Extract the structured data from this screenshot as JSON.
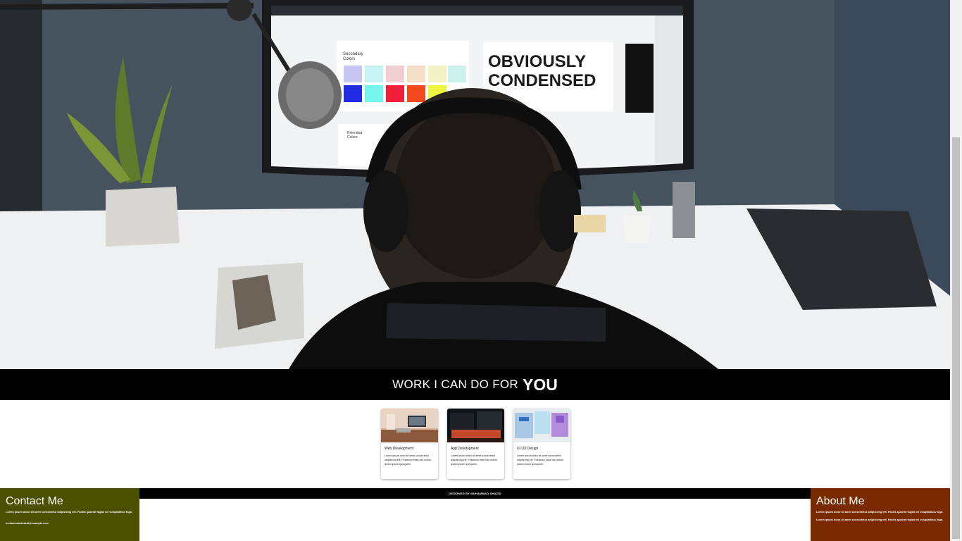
{
  "banner": {
    "prefix": "WORK I CAN DO FOR",
    "emphasis": "YOU"
  },
  "hero": {
    "screen_heading_line1": "OBVIOUSLY",
    "screen_heading_line2": "CONDENSED",
    "screen_label1": "Secondary",
    "screen_label1b": "Colors",
    "screen_label2": "Extended",
    "screen_label2b": "Colors"
  },
  "cards": [
    {
      "title": "Web Development",
      "desc": "Lorem ipsum dolor sit amet consectetur adipisicing elit. Possimus esse iste dolore ipsam ipsum quisquam."
    },
    {
      "title": "App Development",
      "desc": "Lorem ipsum dolor sit amet consectetur adipisicing elit. Possimus esse iste dolore ipsam ipsum quisquam."
    },
    {
      "title": "UI UX Design",
      "desc": "Lorem ipsum dolor sit amet consectetur adipisicing elit. Possimus esse iste dolore ipsam ipsum quisquam."
    }
  ],
  "footer": {
    "credit": "DESIGNED BY MUHAMMAD SHAZID"
  },
  "contact": {
    "title": "Contact Me",
    "text": "Lorem ipsum dolor sit amet consectetur adipisicing elit. Facilis quaerat fugiat vel voluptatibus fuga.",
    "email": "muhammadshazid@example.com"
  },
  "about": {
    "title": "About Me",
    "text": "Lorem ipsum dolor sit amet consectetur adipisicing elit. Facilis quaerat fugiat vel voluptatibus fuga.",
    "text2": "Lorem ipsum dolor sit amet consectetur adipisicing elit. Facilis quaerat fugiat vel voluptatibus fuga."
  },
  "colors": {
    "contact_bg": "#4b5000",
    "about_bg": "#7a2a00",
    "banner_bg": "#000000"
  }
}
